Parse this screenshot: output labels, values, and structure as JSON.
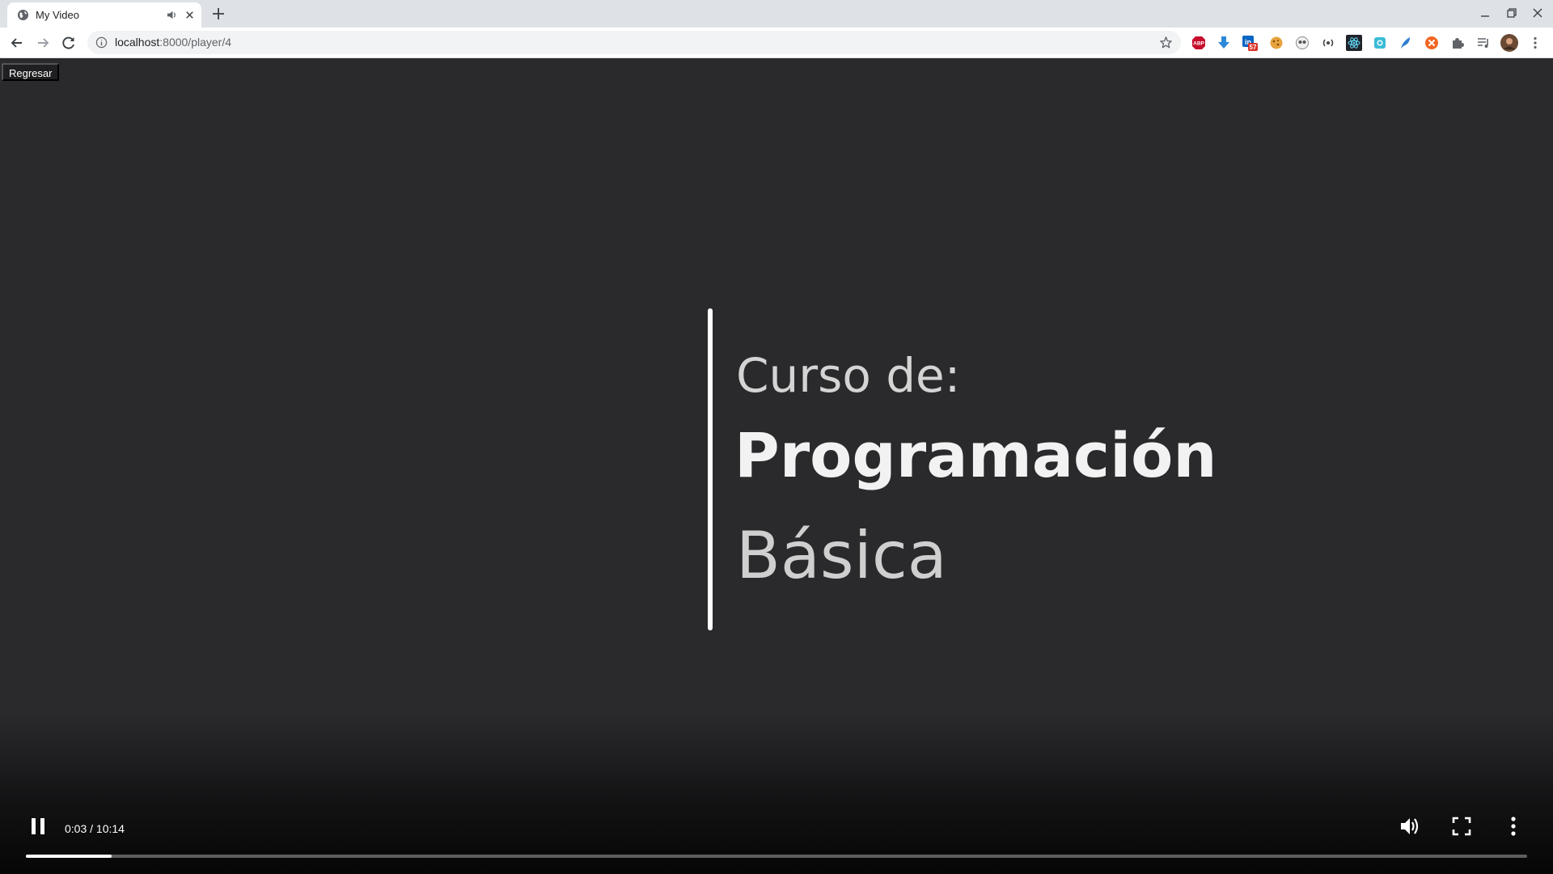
{
  "browser": {
    "tab": {
      "title": "My Video"
    },
    "address": {
      "host": "localhost",
      "path": ":8000/player/4"
    },
    "extensions": [
      {
        "name": "adblock-icon",
        "label": "ABP",
        "color": "#c70d2c"
      },
      {
        "name": "download-icon",
        "color": "#2d88d8"
      },
      {
        "name": "linkedin-icon",
        "badge": "57",
        "color": "#0a66c2"
      },
      {
        "name": "cookie-icon",
        "color": "#e7a33e"
      },
      {
        "name": "owl-icon",
        "color": "#8a8a8a"
      },
      {
        "name": "radio-icon",
        "color": "#444444"
      },
      {
        "name": "react-devtools-icon",
        "color": "#61dafb"
      },
      {
        "name": "camera-icon",
        "color": "#3bbbd6"
      },
      {
        "name": "feather-icon",
        "color": "#2f7dd1"
      },
      {
        "name": "blocker-icon",
        "color": "#f26522"
      }
    ]
  },
  "page": {
    "back_button": "Regresar"
  },
  "video": {
    "slide": {
      "line1": "Curso de:",
      "line2": "Programación",
      "line3": "Básica"
    },
    "current_time": "0:03",
    "duration": "10:14",
    "time_display": "0:03 / 10:14",
    "progress_fraction": 0.057,
    "state": "playing"
  }
}
